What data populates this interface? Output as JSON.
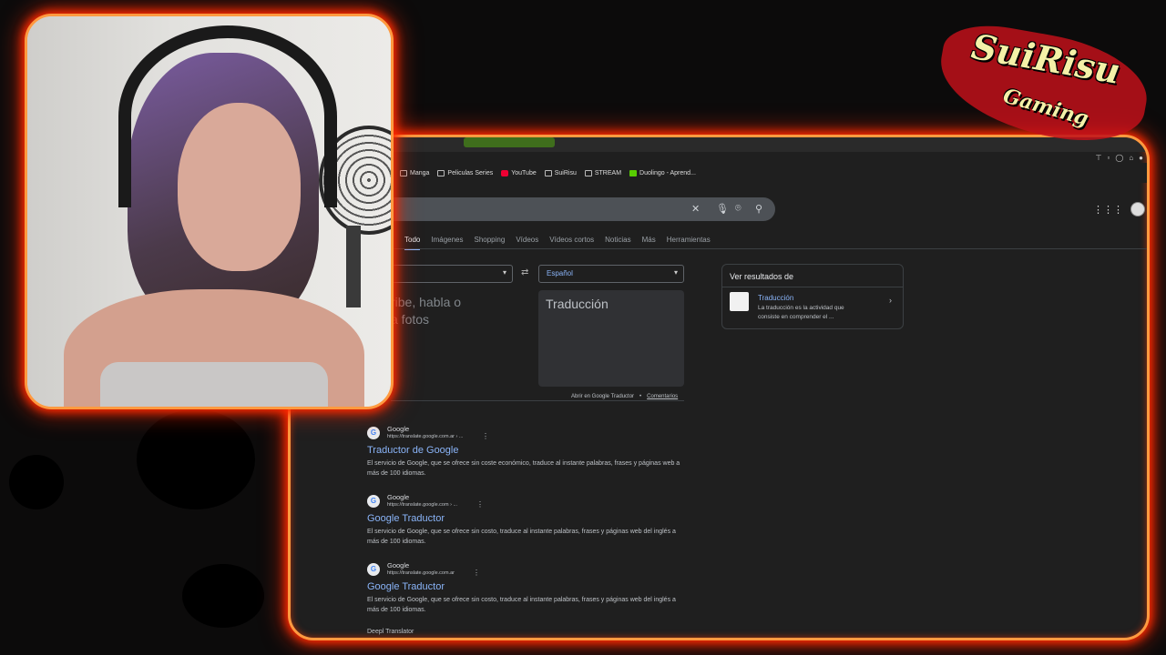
{
  "browser": {
    "bookmarks": [
      {
        "label": "Manga",
        "icon": "folder-icon"
      },
      {
        "label": "Peliculas Series",
        "icon": "folder-icon"
      },
      {
        "label": "YouTube",
        "icon": "youtube-icon"
      },
      {
        "label": "SuiRisu",
        "icon": "folder-icon"
      },
      {
        "label": "STREAM",
        "icon": "folder-icon"
      },
      {
        "label": "Duolingo - Aprend...",
        "icon": "duolingo-icon"
      }
    ],
    "nav_tabs": [
      "Todo",
      "Imágenes",
      "Shopping",
      "Vídeos",
      "Vídeos cortos",
      "Noticias",
      "Más",
      "Herramientas"
    ],
    "translator": {
      "target_lang": "Español",
      "source_placeholder_line1": "ribe, habla o",
      "source_placeholder_line2": "a fotos",
      "target_placeholder": "Traducción",
      "open_link": "Abrir en Google Traductor",
      "feedback_link": "Comentarios"
    },
    "knowledge_panel": {
      "title": "Ver resultados de",
      "link": "Traducción",
      "desc": "La traducción es la actividad que consiste en comprender el ..."
    },
    "results": [
      {
        "site": "Google",
        "url": "https://translate.google.com.ar › ...",
        "title": "Traductor de Google",
        "desc": "El servicio de Google, que se ofrece sin coste económico, traduce al instante palabras, frases y páginas web a más de 100 idiomas."
      },
      {
        "site": "Google",
        "url": "https://translate.google.com › ...",
        "title": "Google Traductor",
        "desc": "El servicio de Google, que se ofrece sin costo, traduce al instante palabras, frases y páginas web del inglés a más de 100 idiomas."
      },
      {
        "site": "Google",
        "url": "https://translate.google.com.ar",
        "title": "Google Traductor",
        "desc": "El servicio de Google, que se ofrece sin costo, traduce al instante palabras, frases y páginas web del inglés a más de 100 idiomas."
      }
    ],
    "partial_result": "Deepl Translator"
  },
  "logo": {
    "main": "SuiRisu",
    "sub": "Gaming"
  },
  "colors": {
    "frame": "#ff9a40",
    "glow": "#ff2a00",
    "link": "#8ab4f8",
    "bg": "#1f1f1f"
  }
}
